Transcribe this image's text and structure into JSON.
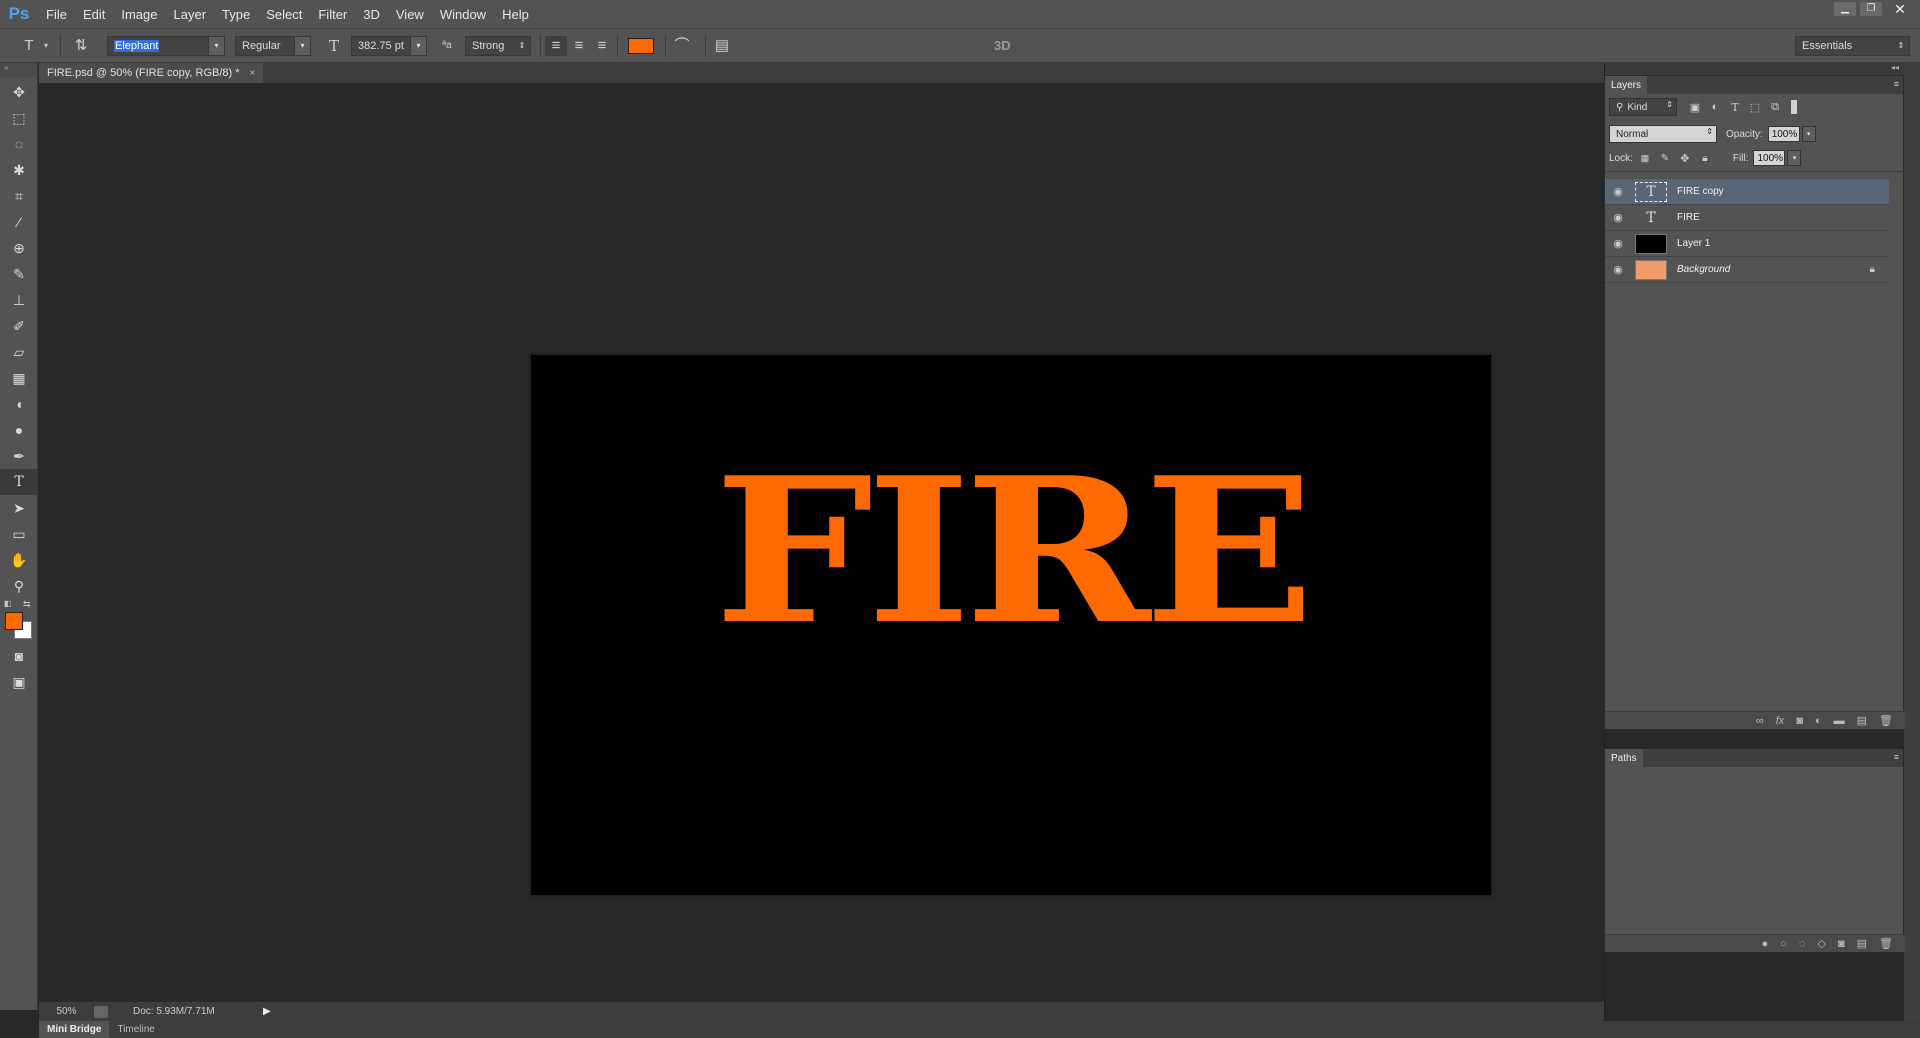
{
  "app": {
    "logo": "Ps"
  },
  "menu": [
    "File",
    "Edit",
    "Image",
    "Layer",
    "Type",
    "Select",
    "Filter",
    "3D",
    "View",
    "Window",
    "Help"
  ],
  "window_controls": {
    "minimize": "▁",
    "restore": "❐",
    "close": "✕"
  },
  "options": {
    "font_family": "Elephant",
    "font_style": "Regular",
    "font_size": "382.75 pt",
    "antialias_icon_text": "ªa",
    "antialias": "Strong",
    "text_color": "#ff6a00",
    "label_3d": "3D",
    "workspace": "Essentials"
  },
  "document": {
    "tab_title": "FIRE.psd @ 50% (FIRE copy, RGB/8) *",
    "close": "×",
    "canvas_text": "FIRE",
    "canvas_text_color": "#ff6a00"
  },
  "status": {
    "zoom": "50%",
    "doc_size": "Doc: 5.93M/7.71M",
    "arrow": "▶"
  },
  "bottom_tabs": [
    "Mini Bridge",
    "Timeline"
  ],
  "tools": {
    "foreground_color": "#ff6a00",
    "background_color": "#ffffff"
  },
  "layers_panel": {
    "title": "Layers",
    "filter_kind": "Kind",
    "blend_mode": "Normal",
    "opacity_label": "Opacity:",
    "opacity": "100%",
    "lock_label": "Lock:",
    "fill_label": "Fill:",
    "fill": "100%",
    "layers": [
      {
        "name": "FIRE copy",
        "type": "text",
        "selected": true,
        "icon": "T"
      },
      {
        "name": "FIRE",
        "type": "text",
        "selected": false,
        "icon": "T"
      },
      {
        "name": "Layer 1",
        "type": "pixel",
        "selected": false,
        "icon": ""
      },
      {
        "name": "Background",
        "type": "background",
        "selected": false,
        "icon": "",
        "locked": true
      }
    ]
  },
  "paths_panel": {
    "title": "Paths"
  }
}
